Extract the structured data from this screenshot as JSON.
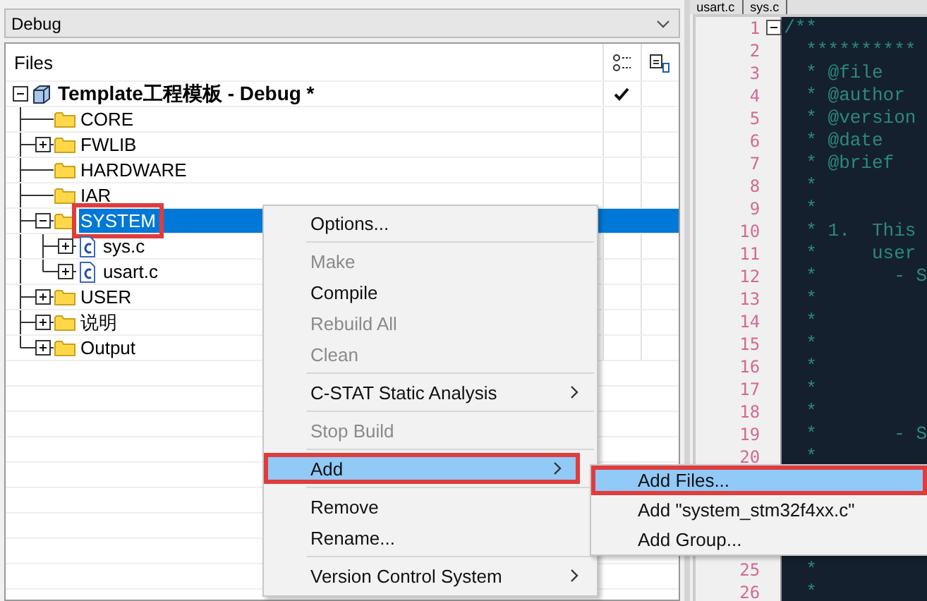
{
  "combo": {
    "value": "Debug"
  },
  "files": {
    "header": "Files",
    "tree": [
      {
        "name": "Template工程模板 - Debug *",
        "kind": "project",
        "expanded": true,
        "selected": false,
        "checked": true,
        "children": [
          {
            "name": "CORE",
            "kind": "folder",
            "selected": false,
            "checked": false
          },
          {
            "name": "FWLIB",
            "kind": "folder",
            "expanded": false,
            "selected": false,
            "checked": false
          },
          {
            "name": "HARDWARE",
            "kind": "folder",
            "selected": false,
            "checked": false
          },
          {
            "name": "IAR",
            "kind": "folder",
            "selected": false,
            "checked": false
          },
          {
            "name": "SYSTEM",
            "kind": "folder",
            "expanded": true,
            "selected": true,
            "checked": false,
            "outlined": true,
            "children": [
              {
                "name": "sys.c",
                "kind": "file",
                "expanded": false,
                "selected": false,
                "checked": false
              },
              {
                "name": "usart.c",
                "kind": "file",
                "expanded": false,
                "selected": false,
                "checked": false
              }
            ]
          },
          {
            "name": "USER",
            "kind": "folder",
            "expanded": false,
            "selected": false,
            "checked": false
          },
          {
            "name": "说明",
            "kind": "folder",
            "expanded": false,
            "selected": false,
            "checked": false
          },
          {
            "name": "Output",
            "kind": "folder",
            "expanded": false,
            "selected": false,
            "checked": false
          }
        ]
      }
    ]
  },
  "context_menu": {
    "items": [
      {
        "kind": "item",
        "label": "Options...",
        "disabled": false,
        "submenu": false,
        "selected": false
      },
      {
        "kind": "separator"
      },
      {
        "kind": "item",
        "label": "Make",
        "disabled": true,
        "submenu": false,
        "selected": false
      },
      {
        "kind": "item",
        "label": "Compile",
        "disabled": false,
        "submenu": false,
        "selected": false
      },
      {
        "kind": "item",
        "label": "Rebuild All",
        "disabled": true,
        "submenu": false,
        "selected": false
      },
      {
        "kind": "item",
        "label": "Clean",
        "disabled": true,
        "submenu": false,
        "selected": false
      },
      {
        "kind": "separator"
      },
      {
        "kind": "item",
        "label": "C-STAT Static Analysis",
        "disabled": false,
        "submenu": true,
        "selected": false
      },
      {
        "kind": "separator"
      },
      {
        "kind": "item",
        "label": "Stop Build",
        "disabled": true,
        "submenu": false,
        "selected": false
      },
      {
        "kind": "separator"
      },
      {
        "kind": "item",
        "label": "Add",
        "disabled": false,
        "submenu": true,
        "selected": true,
        "outlined": true
      },
      {
        "kind": "separator"
      },
      {
        "kind": "item",
        "label": "Remove",
        "disabled": false,
        "submenu": false,
        "selected": false
      },
      {
        "kind": "item",
        "label": "Rename...",
        "disabled": false,
        "submenu": false,
        "selected": false
      },
      {
        "kind": "separator"
      },
      {
        "kind": "item",
        "label": "Version Control System",
        "disabled": false,
        "submenu": true,
        "selected": false
      }
    ]
  },
  "submenu": {
    "items": [
      {
        "kind": "item",
        "label": "Add Files...",
        "disabled": false,
        "submenu": false,
        "selected": true,
        "outlined": true
      },
      {
        "kind": "item",
        "label": "Add \"system_stm32f4xx.c\"",
        "disabled": false,
        "submenu": false,
        "selected": false
      },
      {
        "kind": "item",
        "label": "Add Group...",
        "disabled": false,
        "submenu": false,
        "selected": false
      }
    ]
  },
  "editor": {
    "tabs": [
      "usart.c",
      "sys.c"
    ],
    "lines": [
      {
        "number": "1",
        "code": "/**",
        "fold": true
      },
      {
        "number": "2",
        "code": "  **********"
      },
      {
        "number": "3",
        "code": "  * @file"
      },
      {
        "number": "4",
        "code": "  * @author"
      },
      {
        "number": "5",
        "code": "  * @version"
      },
      {
        "number": "6",
        "code": "  * @date"
      },
      {
        "number": "7",
        "code": "  * @brief"
      },
      {
        "number": "8",
        "code": "  *"
      },
      {
        "number": "9",
        "code": "  *"
      },
      {
        "number": "10",
        "code": "  * 1.  This"
      },
      {
        "number": "11",
        "code": "  *     user"
      },
      {
        "number": "12",
        "code": "  *       - S"
      },
      {
        "number": "13",
        "code": "  *"
      },
      {
        "number": "14",
        "code": "  *"
      },
      {
        "number": "15",
        "code": "  *"
      },
      {
        "number": "16",
        "code": "  *"
      },
      {
        "number": "17",
        "code": "  *"
      },
      {
        "number": "18",
        "code": "  *"
      },
      {
        "number": "19",
        "code": "  *       - S"
      },
      {
        "number": "20",
        "code": "  *"
      }
    ],
    "lines_after_menu": [
      {
        "number": "25",
        "code": "  *"
      },
      {
        "number": "26",
        "code": "  *"
      }
    ]
  }
}
